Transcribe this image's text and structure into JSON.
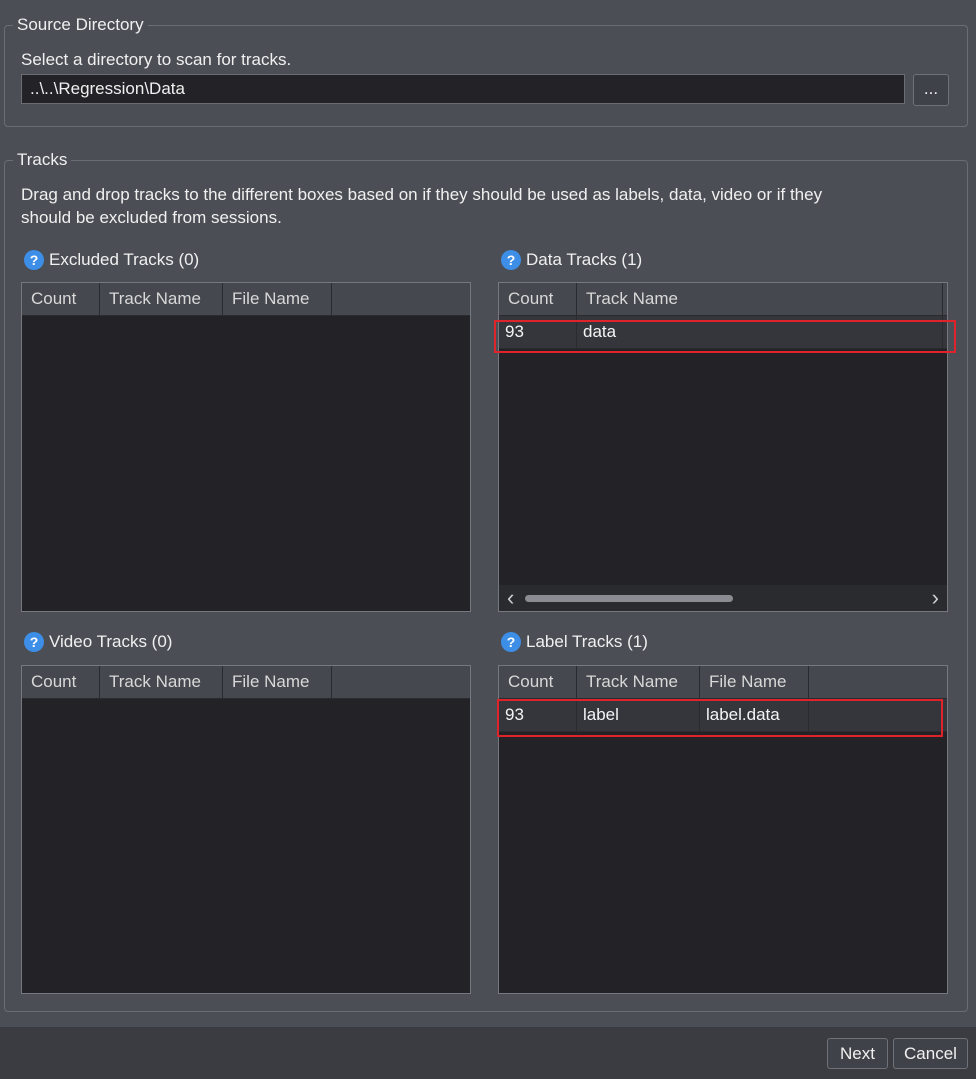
{
  "source": {
    "title": "Source Directory",
    "description": "Select a directory to scan for tracks.",
    "path": "..\\..\\Regression\\Data",
    "browse_label": "..."
  },
  "tracks": {
    "title": "Tracks",
    "description_line1": "Drag and drop tracks to the different boxes based on if they should be used as labels, data, video or if they",
    "description_line2": "should be excluded from sessions.",
    "help_glyph": "?",
    "excluded": {
      "title": "Excluded Tracks (0)",
      "columns": [
        "Count",
        "Track Name",
        "File Name"
      ],
      "rows": []
    },
    "data": {
      "title": "Data Tracks (1)",
      "columns": [
        "Count",
        "Track Name"
      ],
      "rows": [
        {
          "count": "93",
          "track": "data"
        }
      ]
    },
    "video": {
      "title": "Video Tracks (0)",
      "columns": [
        "Count",
        "Track Name",
        "File Name"
      ],
      "rows": []
    },
    "label": {
      "title": "Label Tracks (1)",
      "columns": [
        "Count",
        "Track Name",
        "File Name"
      ],
      "rows": [
        {
          "count": "93",
          "track": "label",
          "file": "label.data"
        }
      ]
    }
  },
  "scroll": {
    "left": "‹",
    "right": "›"
  },
  "footer": {
    "next_label": "Next",
    "cancel_label": "Cancel"
  },
  "colors": {
    "highlight": "#e0222a",
    "help": "#3d8ee6",
    "background": "#4b4e55"
  }
}
